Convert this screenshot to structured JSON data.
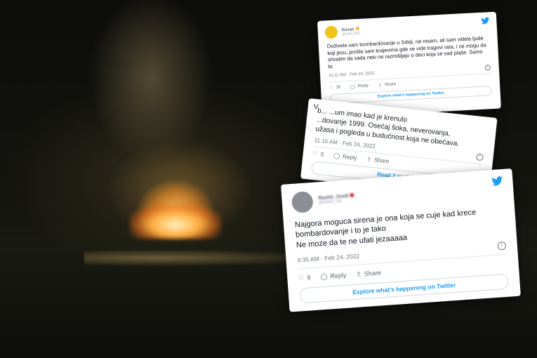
{
  "tweets": [
    {
      "name": "Suzan",
      "handle": "@suhi_blsn",
      "text": "Doživela sam bombardovanje u Srbiji, rat nisam, ali sam videla ljude koji jesu, prošla sam krajevima gde se vide tragovi rata, i ne mogu da shvatim da sada neki ne razmišljaju o deci koja se sad plaše. Samo to.",
      "time": "10:11 AM · Feb 24, 2022",
      "likes": "18",
      "reply": "Reply",
      "share": "Share",
      "explore": "Explore what's happening on Twitter"
    },
    {
      "partial_prefix": "V",
      "text_line1": "b... ...um imao kad je krenulo",
      "text_line2": "...dovanje 1999. Osećaj šoka, neverovanja,",
      "text_line3": "užasa i pogleda u budućnost koja ne obećava.",
      "time": "11:16 AM · Feb 24, 2022",
      "likes": "5",
      "reply": "Reply",
      "share": "Share",
      "read_replies": "Read 2 replies"
    },
    {
      "name": "Rashh_Oreill",
      "handle": "@rashh_O8",
      "text_line1": "Najgora moguca sirena je ona koja se cuje kad krece",
      "text_line2": "bombardovanje i to je tako",
      "text_line3": "Ne moze da te ne ufati jezaaaaa",
      "time": "9:35 AM · Feb 24, 2022",
      "likes": "9",
      "reply": "Reply",
      "share": "Share",
      "explore": "Explore what's happening on Twitter"
    }
  ],
  "icons": {
    "twitter": "twitter-bird-icon",
    "like": "heart-icon",
    "reply": "reply-icon",
    "share": "share-icon",
    "info": "info-icon"
  },
  "colors": {
    "twitter_blue": "#1d9bf0",
    "fire": "#ffb347"
  }
}
